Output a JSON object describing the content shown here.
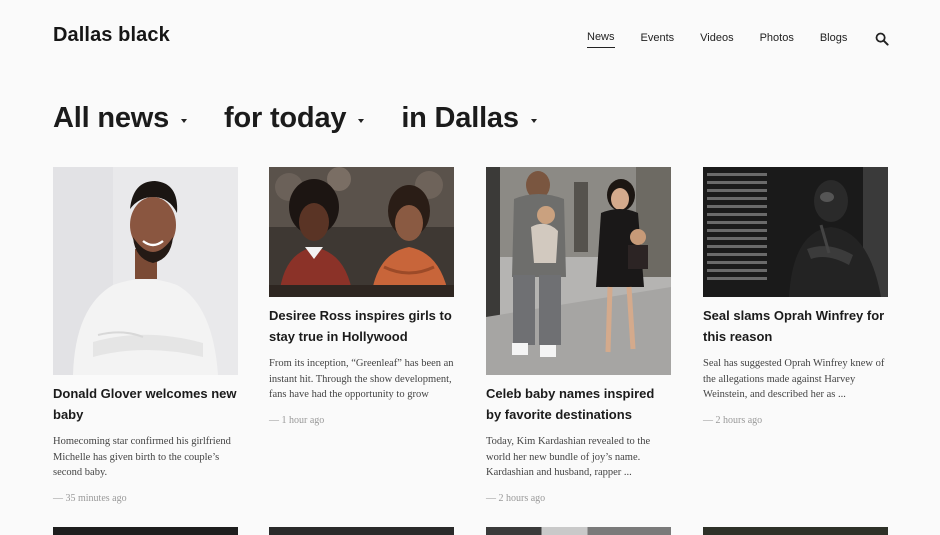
{
  "brand": "Dallas black",
  "nav": {
    "items": [
      "News",
      "Events",
      "Videos",
      "Photos",
      "Blogs"
    ],
    "active": "News"
  },
  "filters": {
    "topic": "All news",
    "time": "for today",
    "place": "in Dallas"
  },
  "articles": [
    {
      "title": "Donald Glover welcomes new baby",
      "excerpt": "Homecoming star confirmed his girlfriend Michelle has given birth to the couple’s second baby.",
      "time": "— 35 minutes ago"
    },
    {
      "title": "Desiree Ross inspires girls to stay true in Hollywood",
      "excerpt": "From its inception, “Greenleaf” has been an instant hit. Through the show development, fans have had the opportunity to grow",
      "time": "— 1 hour ago"
    },
    {
      "title": "Celeb baby names inspired by favorite destinations",
      "excerpt": "Today, Kim Kardashian revealed to the world her new bundle of joy’s name. Kardashian and husband, rapper ...",
      "time": "— 2 hours ago"
    },
    {
      "title": "Seal slams Oprah Winfrey for this reason",
      "excerpt": "Seal has suggested Oprah Winfrey knew of the allegations made against Harvey Weinstein, and described her as ...",
      "time": "— 2 hours ago"
    }
  ],
  "colors": {
    "text": "#1b1b1b",
    "muted": "#999999",
    "background": "#fafafa"
  }
}
